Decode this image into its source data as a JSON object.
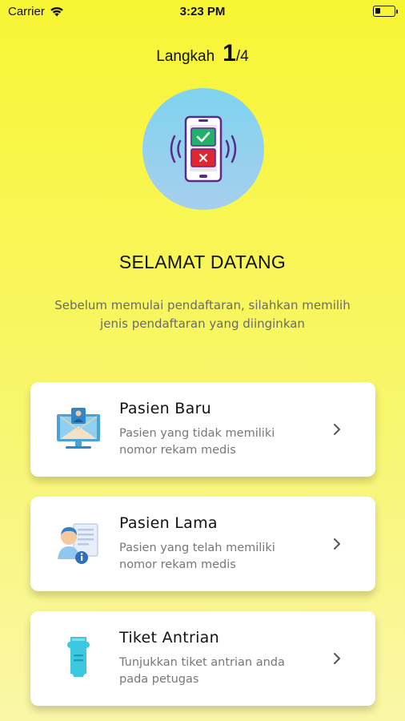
{
  "status_bar": {
    "carrier": "Carrier",
    "time": "3:23 PM"
  },
  "step": {
    "label": "Langkah",
    "current": "1",
    "total": "/4"
  },
  "welcome": {
    "title": "SELAMAT DATANG",
    "subtitle_line1": "Sebelum memulai pendaftaran, silahkan memilih",
    "subtitle_line2": "jenis pendaftaran yang diinginkan"
  },
  "options": [
    {
      "title": "Pasien Baru",
      "desc_line1": "Pasien yang tidak memiliki",
      "desc_line2": "nomor rekam medis",
      "icon": "computer-user-icon"
    },
    {
      "title": "Pasien Lama",
      "desc_line1": "Pasien yang telah memiliki",
      "desc_line2": "nomor rekam medis",
      "icon": "patient-record-icon"
    },
    {
      "title": "Tiket Antrian",
      "desc_line1": "Tunjukkan tiket antrian anda",
      "desc_line2": "pada petugas",
      "icon": "ticket-icon"
    }
  ],
  "colors": {
    "background_top": "#f8f534",
    "background_bottom": "#faf7a8",
    "hero_circle": "#7fd3ee",
    "card": "#ffffff"
  }
}
